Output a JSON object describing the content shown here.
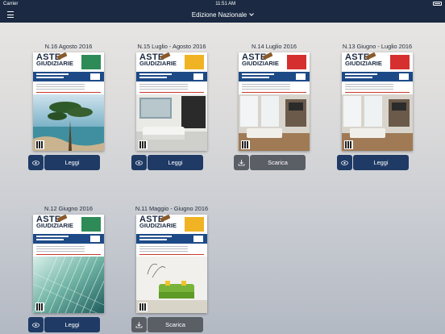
{
  "status_bar": {
    "carrier": "Carrier",
    "time": "11:51 AM"
  },
  "nav": {
    "title": "Edizione Nazionale",
    "menu_icon": "hamburger-icon"
  },
  "issues": [
    {
      "title": "N.16 Agosto 2016",
      "badge_color": "#2e8b57",
      "photo": "tree-photo",
      "action": "Leggi",
      "action_icon": "eye-icon",
      "downloaded": true
    },
    {
      "title": "N.15  Luglio - Agosto 2016",
      "badge_color": "#f0b323",
      "photo": "interior-photo",
      "action": "Leggi",
      "action_icon": "eye-icon",
      "downloaded": true
    },
    {
      "title": "N.14 Luglio 2016",
      "badge_color": "#d62f2f",
      "photo": "living-room-photo",
      "action": "Scarica",
      "action_icon": "download-icon",
      "downloaded": false
    },
    {
      "title": "N.13  Giugno - Luglio 2016",
      "badge_color": "#d62f2f",
      "photo": "living-room-photo",
      "action": "Leggi",
      "action_icon": "eye-icon",
      "downloaded": true
    },
    {
      "title": "N.12 Giugno 2016",
      "badge_color": "#2e8b57",
      "photo": "glass-building-photo",
      "action": "Leggi",
      "action_icon": "eye-icon",
      "downloaded": true
    },
    {
      "title": "N.11  Maggio - Giugno 2016",
      "badge_color": "#f0b323",
      "photo": "green-sofa-photo",
      "action": "Scarica",
      "action_icon": "download-icon",
      "downloaded": false
    }
  ]
}
